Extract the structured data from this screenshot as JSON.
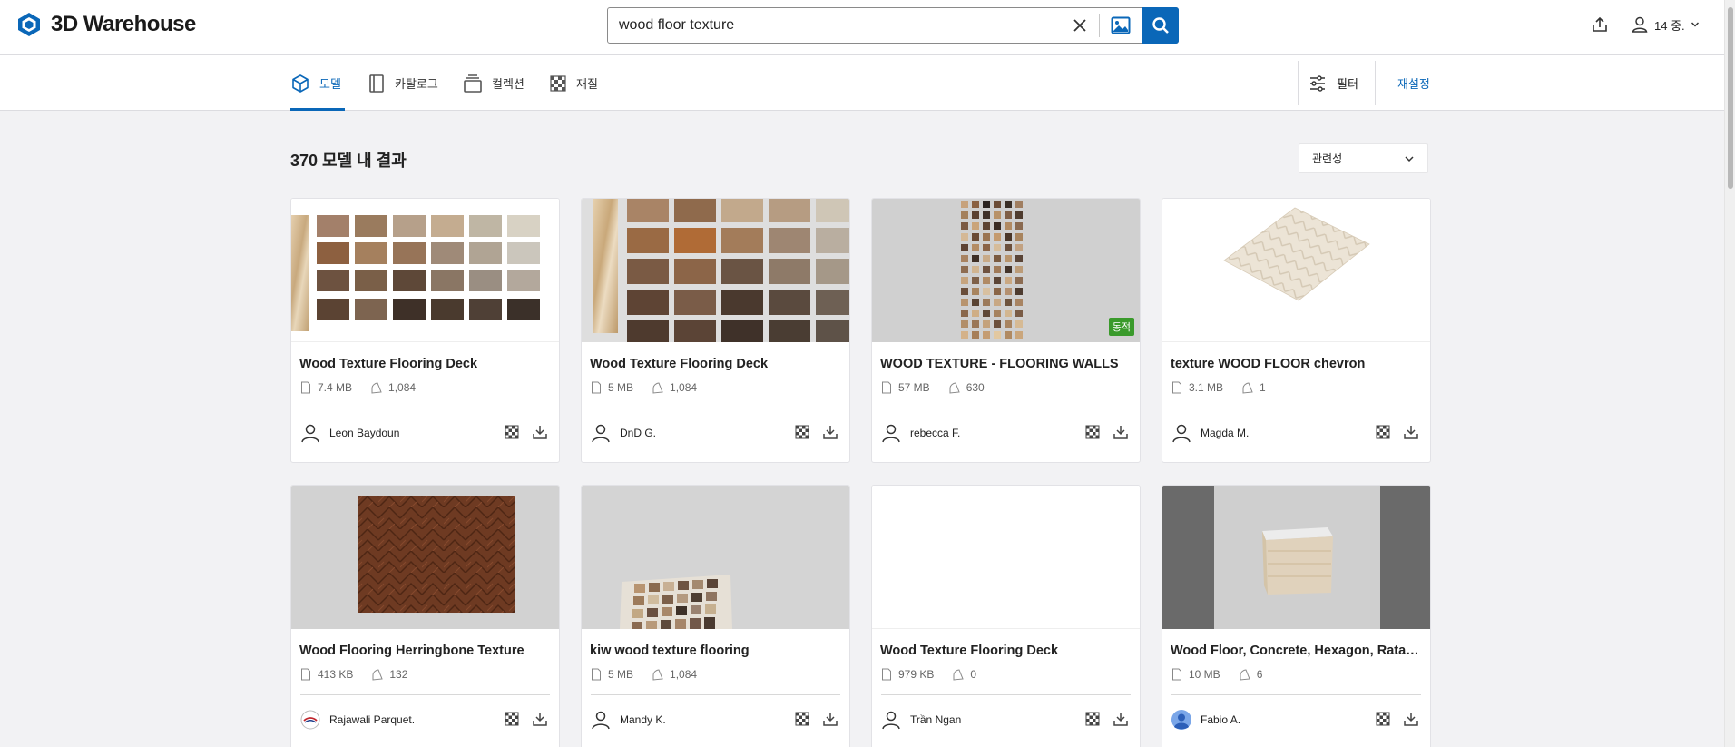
{
  "header": {
    "logo_text": "3D Warehouse",
    "search": {
      "value": "wood floor texture",
      "placeholder": ""
    },
    "user_label": "14 중."
  },
  "nav": {
    "tabs": [
      {
        "label": "모델",
        "icon": "cube-icon",
        "active": true
      },
      {
        "label": "카탈로그",
        "icon": "catalog-icon",
        "active": false
      },
      {
        "label": "컬렉션",
        "icon": "collection-icon",
        "active": false
      },
      {
        "label": "재질",
        "icon": "material-icon",
        "active": false
      }
    ],
    "filter_label": "필터",
    "reset_label": "재설정"
  },
  "results": {
    "title": "370 모델 내 결과",
    "sort_label": "관련성"
  },
  "colors": {
    "accent": "#0a67b8",
    "badge_green": "#3a9a2b"
  },
  "cards": [
    {
      "title": "Wood Texture Flooring Deck",
      "size": "7.4 MB",
      "likes": "1,084",
      "author": "Leon Baydoun",
      "thumb": "swatch-grid-white"
    },
    {
      "title": "Wood Texture Flooring Deck",
      "size": "5 MB",
      "likes": "1,084",
      "author": "DnD G.",
      "thumb": "swatch-grid-gray"
    },
    {
      "title": "WOOD TEXTURE - FLOORING WALLS",
      "size": "57 MB",
      "likes": "630",
      "author": "rebecca F.",
      "thumb": "swatch-column",
      "badge": "동적"
    },
    {
      "title": "texture WOOD FLOOR chevron",
      "size": "3.1 MB",
      "likes": "1",
      "author": "Magda M.",
      "thumb": "tilted-tile"
    },
    {
      "title": "Wood Flooring Herringbone Texture",
      "size": "413 KB",
      "likes": "132",
      "author": "Rajawali Parquet.",
      "thumb": "herringbone"
    },
    {
      "title": "kiw wood texture flooring",
      "size": "5 MB",
      "likes": "1,084",
      "author": "Mandy K.",
      "thumb": "perspective-board"
    },
    {
      "title": "Wood Texture Flooring Deck",
      "size": "979 KB",
      "likes": "0",
      "author": "Trần Ngan",
      "thumb": "blank"
    },
    {
      "title": "Wood Floor, Concrete, Hexagon, Ratan ...",
      "size": "10 MB",
      "likes": "6",
      "author": "Fabio A.",
      "thumb": "cube-box"
    }
  ]
}
